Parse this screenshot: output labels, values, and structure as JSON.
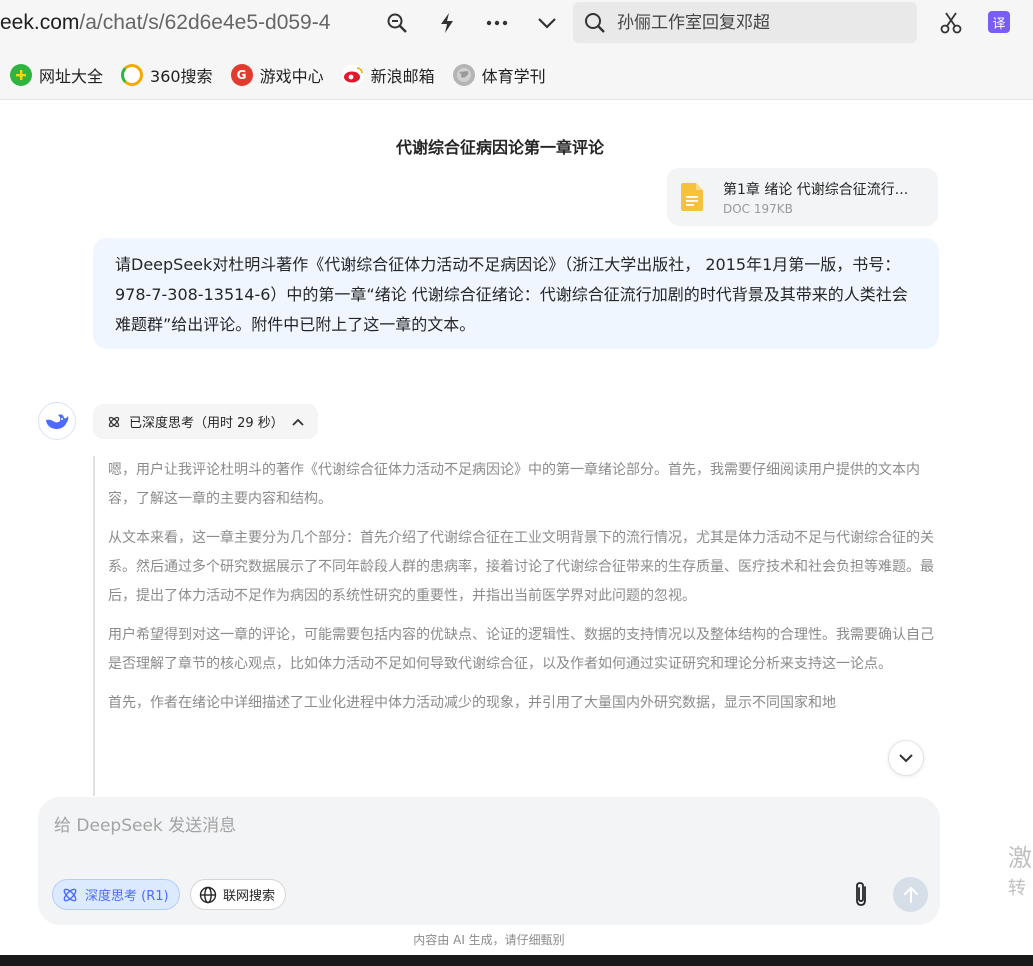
{
  "browser": {
    "url_domain": "eek.com",
    "url_path": "/a/chat/s/62d6e4e5-d059-4",
    "search_placeholder": "孙俪工作室回复邓超",
    "translate_label": "译"
  },
  "bookmarks": [
    {
      "label": "网址大全",
      "icon": "plus-circle-icon",
      "color": "#2fb53f"
    },
    {
      "label": "360搜索",
      "icon": "search-360-icon",
      "color": "#f2a900"
    },
    {
      "label": "游戏中心",
      "icon": "game-icon",
      "color": "#e23b2e"
    },
    {
      "label": "新浪邮箱",
      "icon": "weibo-icon",
      "color": "#e6162d"
    },
    {
      "label": "体育学刊",
      "icon": "globe-icon",
      "color": "#9a9a9a"
    }
  ],
  "chat": {
    "title": "代谢综合征病因论第一章评论",
    "file": {
      "name": "第1章 绪论 代谢综合征流行...",
      "meta": "DOC 197KB"
    },
    "user_message": "请DeepSeek对杜明斗著作《代谢综合征体力活动不足病因论》（浙江大学出版社， 2015年1月第一版，书号：978-7-308-13514-6）中的第一章“绪论 代谢综合征绪论：代谢综合征流行加剧的时代背景及其带来的人类社会难题群”给出评论。附件中已附上了这一章的文本。",
    "think_label": "已深度思考（用时 29 秒）",
    "thought_paragraphs": [
      "嗯，用户让我评论杜明斗的著作《代谢综合征体力活动不足病因论》中的第一章绪论部分。首先，我需要仔细阅读用户提供的文本内容，了解这一章的主要内容和结构。",
      "从文本来看，这一章主要分为几个部分：首先介绍了代谢综合征在工业文明背景下的流行情况，尤其是体力活动不足与代谢综合征的关系。然后通过多个研究数据展示了不同年龄段人群的患病率，接着讨论了代谢综合征带来的生存质量、医疗技术和社会负担等难题。最后，提出了体力活动不足作为病因的系统性研究的重要性，并指出当前医学界对此问题的忽视。",
      "用户希望得到对这一章的评论，可能需要包括内容的优缺点、论证的逻辑性、数据的支持情况以及整体结构的合理性。我需要确认自己是否理解了章节的核心观点，比如体力活动不足如何导致代谢综合征，以及作者如何通过实证研究和理论分析来支持这一论点。",
      "首先，作者在绪论中详细描述了工业化进程中体力活动减少的现象，并引用了大量国内外研究数据，显示不同国家和地"
    ]
  },
  "composer": {
    "placeholder": "给 DeepSeek 发送消息",
    "deep_think_label": "深度思考 (R1)",
    "web_search_label": "联网搜索"
  },
  "footer_note": "内容由 AI 生成，请仔细甄别",
  "side": {
    "line1": "激",
    "line2": "转"
  }
}
